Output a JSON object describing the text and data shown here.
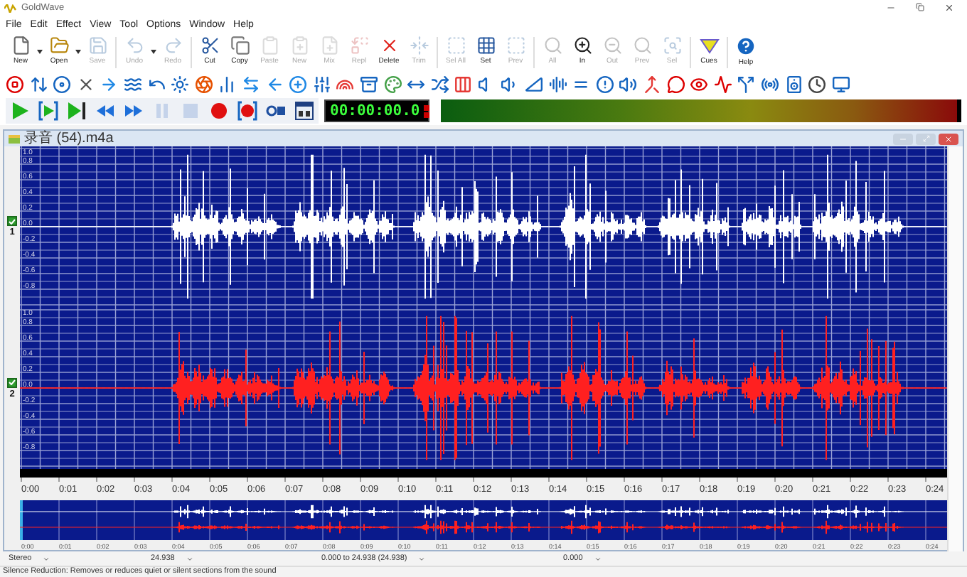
{
  "window": {
    "title": "GoldWave"
  },
  "menu": [
    "File",
    "Edit",
    "Effect",
    "View",
    "Tool",
    "Options",
    "Window",
    "Help"
  ],
  "toolbar": [
    {
      "kind": "new",
      "label": "New",
      "disabled": false,
      "has_menu": true
    },
    {
      "kind": "open",
      "label": "Open",
      "disabled": false,
      "has_menu": true
    },
    {
      "kind": "save",
      "label": "Save",
      "disabled": true,
      "has_menu": false
    },
    {
      "kind": "undo",
      "label": "Undo",
      "disabled": true,
      "has_menu": true
    },
    {
      "kind": "redo",
      "label": "Redo",
      "disabled": true,
      "has_menu": false
    },
    {
      "kind": "cut",
      "label": "Cut",
      "disabled": false,
      "has_menu": false
    },
    {
      "kind": "copy",
      "label": "Copy",
      "disabled": false,
      "has_menu": false
    },
    {
      "kind": "paste",
      "label": "Paste",
      "disabled": true,
      "has_menu": false
    },
    {
      "kind": "pastenew",
      "label": "New",
      "disabled": true,
      "has_menu": false
    },
    {
      "kind": "mix",
      "label": "Mix",
      "disabled": true,
      "has_menu": false
    },
    {
      "kind": "replace",
      "label": "Repl",
      "disabled": true,
      "has_menu": false
    },
    {
      "kind": "delete",
      "label": "Delete",
      "disabled": false,
      "has_menu": false
    },
    {
      "kind": "trim",
      "label": "Trim",
      "disabled": true,
      "has_menu": false
    },
    {
      "kind": "selectall",
      "label": "Sel All",
      "disabled": true,
      "has_menu": false
    },
    {
      "kind": "set",
      "label": "Set",
      "disabled": false,
      "has_menu": false
    },
    {
      "kind": "preview",
      "label": "Prev",
      "disabled": true,
      "has_menu": false
    },
    {
      "kind": "zoomall",
      "label": "All",
      "disabled": true,
      "has_menu": false
    },
    {
      "kind": "zoomin",
      "label": "In",
      "disabled": false,
      "has_menu": false
    },
    {
      "kind": "zoomout",
      "label": "Out",
      "disabled": true,
      "has_menu": false
    },
    {
      "kind": "zoomprev",
      "label": "Prev",
      "disabled": true,
      "has_menu": false
    },
    {
      "kind": "zoomsel",
      "label": "Sel",
      "disabled": true,
      "has_menu": false
    },
    {
      "kind": "cues",
      "label": "Cues",
      "disabled": false,
      "has_menu": false
    },
    {
      "kind": "help",
      "label": "Help",
      "disabled": false,
      "has_menu": false
    }
  ],
  "transport": [
    {
      "kind": "play",
      "disabled": false
    },
    {
      "kind": "play-selection",
      "disabled": false
    },
    {
      "kind": "play-end",
      "disabled": false
    },
    {
      "kind": "rewind",
      "disabled": false
    },
    {
      "kind": "forward",
      "disabled": false
    },
    {
      "kind": "pause",
      "disabled": true
    },
    {
      "kind": "stop",
      "disabled": true
    },
    {
      "kind": "record",
      "disabled": false
    },
    {
      "kind": "record-selection",
      "disabled": false
    },
    {
      "kind": "properties",
      "disabled": false
    },
    {
      "kind": "device",
      "disabled": false
    }
  ],
  "timer": "00:00:00.0",
  "document": {
    "title": "录音 (54).m4a",
    "channels": [
      {
        "number": "1",
        "checked": true,
        "color": "#ffffff",
        "ticks": [
          "1.0",
          "0.8",
          "0.6",
          "0.4",
          "0.2",
          "0.0",
          "-0.2",
          "-0.4",
          "-0.6",
          "-0.8"
        ]
      },
      {
        "number": "2",
        "checked": true,
        "color": "#ff2020",
        "ticks": [
          "1.0",
          "0.8",
          "0.6",
          "0.4",
          "0.2",
          "0.0",
          "-0.2",
          "-0.4",
          "-0.6",
          "-0.8"
        ]
      }
    ],
    "time_labels": [
      "0:00",
      "0:01",
      "0:02",
      "0:03",
      "0:04",
      "0:05",
      "0:06",
      "0:07",
      "0:08",
      "0:09",
      "0:10",
      "0:11",
      "0:12",
      "0:13",
      "0:14",
      "0:15",
      "0:16",
      "0:17",
      "0:18",
      "0:19",
      "0:20",
      "0:21",
      "0:22",
      "0:23",
      "0:24"
    ],
    "overview_labels": [
      "0:00",
      "0:01",
      "0:02",
      "0:03",
      "0:04",
      "0:05",
      "0:06",
      "0:07",
      "0:08",
      "0:09",
      "0:10",
      "0:11",
      "0:12",
      "0:13",
      "0:14",
      "0:15",
      "0:16",
      "0:17",
      "0:18",
      "0:19",
      "0:20",
      "0:21",
      "0:22",
      "0:23",
      "0:24"
    ]
  },
  "status_bar": {
    "fields": [
      "Stereo",
      "24.938",
      "0.000 to 24.938 (24.938)",
      "0.000"
    ],
    "hint": "Silence Reduction: Removes or reduces quiet or silent sections from the sound"
  }
}
